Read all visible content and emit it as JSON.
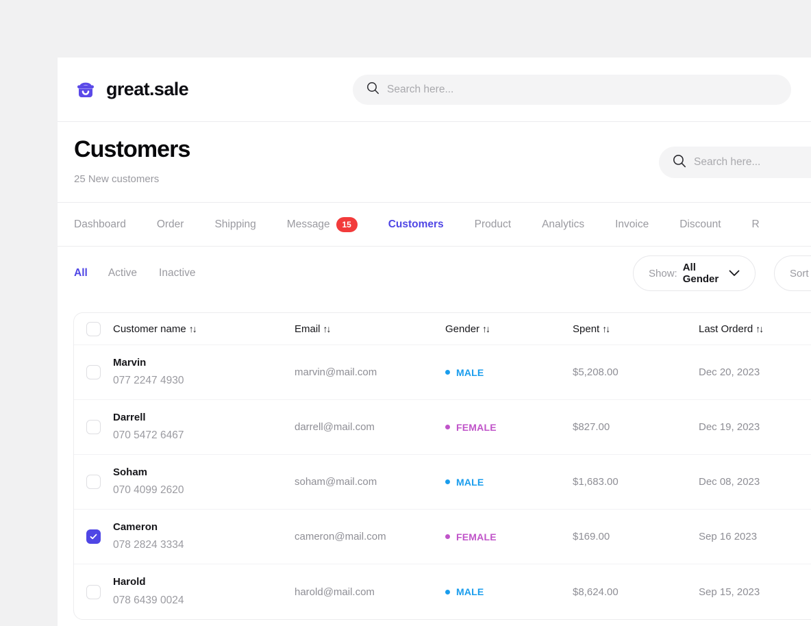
{
  "brand": {
    "name": "great.sale",
    "logo_icon": "shopping-basket-icon",
    "color": "#5b4ae8"
  },
  "top_search": {
    "placeholder": "Search here...",
    "value": "",
    "icon": "search-icon"
  },
  "header": {
    "title": "Customers",
    "subtitle": "25 New customers",
    "search": {
      "placeholder": "Search here...",
      "value": "",
      "icon": "search-icon"
    }
  },
  "tabs": [
    {
      "label": "Dashboard",
      "active": false,
      "badge": null
    },
    {
      "label": "Order",
      "active": false,
      "badge": null
    },
    {
      "label": "Shipping",
      "active": false,
      "badge": null
    },
    {
      "label": "Message",
      "active": false,
      "badge": "15"
    },
    {
      "label": "Customers",
      "active": true,
      "badge": null
    },
    {
      "label": "Product",
      "active": false,
      "badge": null
    },
    {
      "label": "Analytics",
      "active": false,
      "badge": null
    },
    {
      "label": "Invoice",
      "active": false,
      "badge": null
    },
    {
      "label": "Discount",
      "active": false,
      "badge": null
    },
    {
      "label": "R",
      "active": false,
      "badge": null
    }
  ],
  "segments": [
    {
      "label": "All",
      "active": true
    },
    {
      "label": "Active",
      "active": false
    },
    {
      "label": "Inactive",
      "active": false
    }
  ],
  "filters": {
    "show": {
      "label": "Show:",
      "value": "All Gender",
      "icon": "chevron-down-icon"
    },
    "sort": {
      "label": "Sort by",
      "value": "",
      "icon": "chevron-down-icon"
    }
  },
  "table": {
    "columns": [
      {
        "key": "name",
        "label": "Customer name",
        "sort_icon": "sort-updown-icon"
      },
      {
        "key": "email",
        "label": "Email",
        "sort_icon": "sort-updown-icon"
      },
      {
        "key": "gender",
        "label": "Gender",
        "sort_icon": "sort-updown-icon"
      },
      {
        "key": "spent",
        "label": "Spent",
        "sort_icon": "sort-updown-icon"
      },
      {
        "key": "date",
        "label": "Last Orderd",
        "sort_icon": "sort-updown-icon"
      }
    ],
    "gender_colors": {
      "MALE": "#1a9ded",
      "FEMALE": "#c054c9"
    },
    "rows": [
      {
        "checked": false,
        "name": "Marvin",
        "phone": "077 2247 4930",
        "email": "marvin@mail.com",
        "gender": "MALE",
        "spent": "$5,208.00",
        "date": "Dec 20, 2023"
      },
      {
        "checked": false,
        "name": "Darrell",
        "phone": "070 5472 6467",
        "email": "darrell@mail.com",
        "gender": "FEMALE",
        "spent": "$827.00",
        "date": "Dec 19, 2023"
      },
      {
        "checked": false,
        "name": "Soham",
        "phone": "070 4099 2620",
        "email": "soham@mail.com",
        "gender": "MALE",
        "spent": "$1,683.00",
        "date": "Dec 08, 2023"
      },
      {
        "checked": true,
        "name": "Cameron",
        "phone": "078 2824 3334",
        "email": "cameron@mail.com",
        "gender": "FEMALE",
        "spent": "$169.00",
        "date": "Sep 16 2023"
      },
      {
        "checked": false,
        "name": "Harold",
        "phone": "078 6439 0024",
        "email": "harold@mail.com",
        "gender": "MALE",
        "spent": "$8,624.00",
        "date": "Sep 15, 2023"
      }
    ]
  }
}
